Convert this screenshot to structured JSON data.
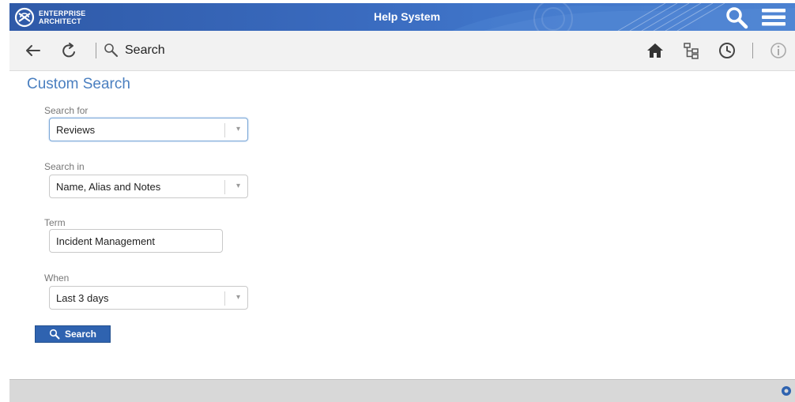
{
  "header": {
    "brand_line1": "ENTERPRISE",
    "brand_line2": "ARCHITECT",
    "title": "Help System",
    "search_icon": "search-icon",
    "menu_icon": "hamburger-menu-icon"
  },
  "toolbar": {
    "back_icon": "back-arrow-icon",
    "refresh_icon": "refresh-icon",
    "search_label": "Search",
    "home_icon": "home-icon",
    "tree_icon": "tree-icon",
    "history_icon": "clock-icon",
    "info_icon": "info-icon"
  },
  "main": {
    "title": "Custom Search",
    "search_for": {
      "label": "Search for",
      "value": "Reviews"
    },
    "search_in": {
      "label": "Search in",
      "value": "Name, Alias and Notes"
    },
    "term": {
      "label": "Term",
      "value": "Incident Management"
    },
    "when": {
      "label": "When",
      "value": "Last 3 days"
    },
    "search_button": "Search"
  },
  "colors": {
    "header_blue": "#3a6bbf",
    "accent_title": "#4a7fc0",
    "button_blue": "#2f63b0"
  }
}
